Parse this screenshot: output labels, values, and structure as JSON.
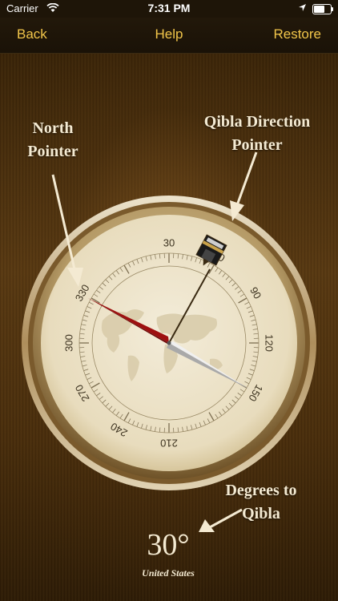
{
  "status": {
    "carrier": "Carrier",
    "time": "7:31 PM"
  },
  "nav": {
    "back_label": "Back",
    "help_label": "Help",
    "restore_label": "Restore"
  },
  "annotations": {
    "north_pointer": [
      "North",
      "Pointer"
    ],
    "qibla_pointer": [
      "Qibla Direction",
      "Pointer"
    ],
    "degrees_to_qibla": [
      "Degrees to",
      "Qibla"
    ]
  },
  "compass": {
    "dial_labels": [
      "30",
      "60",
      "90",
      "120",
      "150",
      "210",
      "240",
      "270",
      "300",
      "330"
    ],
    "north_needle_color": "#9e1010",
    "south_needle_color": "#d9d9d9"
  },
  "readout": {
    "degrees": "30°",
    "country": "United States"
  },
  "colors": {
    "nav_accent": "#f2c64a",
    "annotation_text": "#f4ead2",
    "dial_face": "#efe6cf"
  },
  "icons": {
    "wifi": "wifi-icon",
    "location": "location-arrow-icon",
    "battery": "battery-icon",
    "kaaba": "kaaba-icon"
  }
}
